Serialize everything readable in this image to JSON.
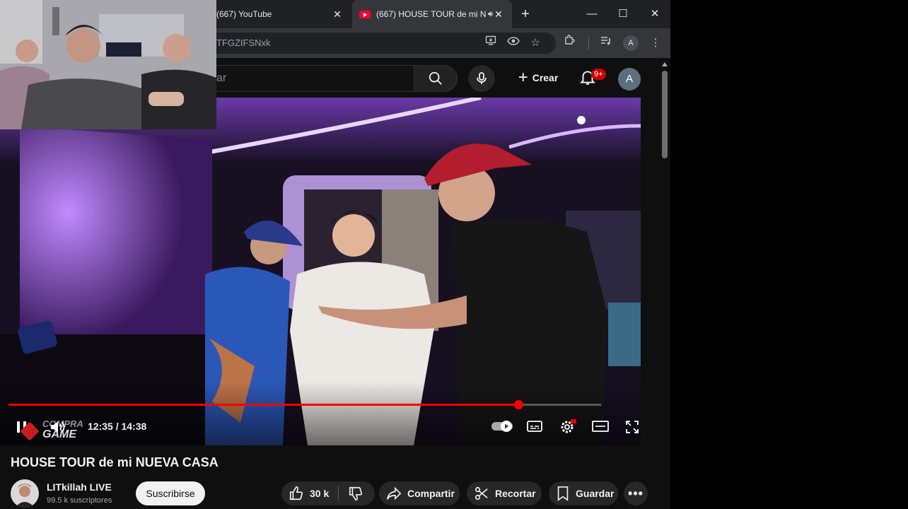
{
  "browser": {
    "tabs": [
      {
        "title": "(667) YouTube",
        "active": false
      },
      {
        "title": "(667) HOUSE TOUR de mi N",
        "active": true,
        "audio": true
      }
    ],
    "url": "TFGZIFSNxk",
    "profile_initial": "A"
  },
  "youtube": {
    "search_placeholder": "ar",
    "create_label": "Crear",
    "notifications": "9+",
    "avatar_initial": "A"
  },
  "player": {
    "current_time": "12:35",
    "duration": "14:38",
    "time_display": "12:35 / 14:38",
    "progress": 0.86,
    "buffered": 0.99,
    "watermark_top": "COMPRA",
    "watermark_bottom": "GAME"
  },
  "video": {
    "title": "HOUSE TOUR de mi NUEVA CASA",
    "channel": "LITkillah LIVE",
    "subscribers": "99.5 k suscriptores",
    "subscribe_label": "Suscribirse",
    "likes": "30 k",
    "share_label": "Compartir",
    "clip_label": "Recortar",
    "save_label": "Guardar"
  },
  "colors": {
    "accent_red": "#ff0000",
    "bg": "#0f0f0f",
    "ambient_purple": "#b25cff"
  }
}
